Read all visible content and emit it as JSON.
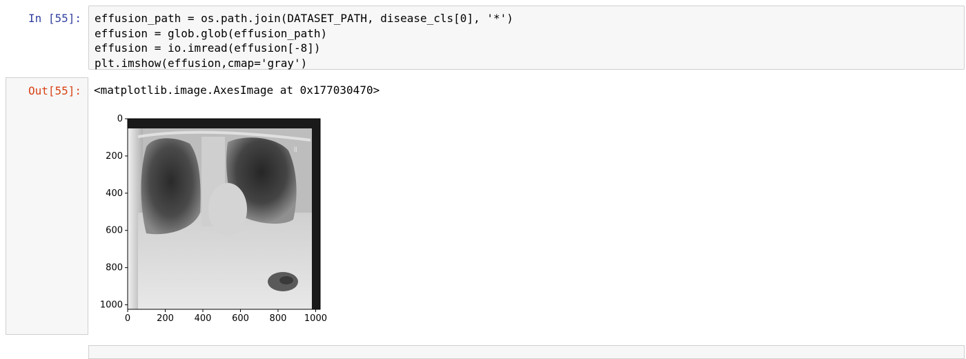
{
  "cells": {
    "input": {
      "prompt": "In [55]:",
      "lines": [
        "effusion_path = os.path.join(DATASET_PATH, disease_cls[0], '*')",
        "effusion = glob.glob(effusion_path)",
        "effusion = io.imread(effusion[-8])",
        "plt.imshow(effusion,cmap='gray')"
      ]
    },
    "output": {
      "prompt": "Out[55]:",
      "text": "<matplotlib.image.AxesImage at 0x177030470>"
    }
  },
  "chart_data": {
    "type": "image",
    "cmap": "gray",
    "xlim": [
      0,
      1024
    ],
    "ylim": [
      1024,
      0
    ],
    "x_ticks": [
      0,
      200,
      400,
      600,
      800,
      1000
    ],
    "y_ticks": [
      0,
      200,
      400,
      600,
      800,
      1000
    ],
    "x_tick_labels": [
      "0",
      "200",
      "400",
      "600",
      "800",
      "1000"
    ],
    "y_tick_labels": [
      "0",
      "200",
      "400",
      "600",
      "800",
      "1000"
    ],
    "grid": false
  }
}
